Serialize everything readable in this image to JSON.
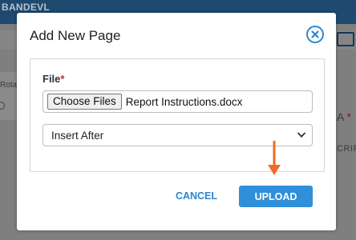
{
  "background": {
    "brand": "BANDEVL",
    "left_label": "Rota",
    "right_label": "A",
    "right_required_mark": "*",
    "right_partial_text": "CRIP"
  },
  "modal": {
    "title": "Add New Page",
    "close_icon": "close-circle-icon",
    "file_field": {
      "label": "File",
      "required_mark": "*",
      "choose_button": "Choose Files",
      "selected_file": "Report Instructions.docx"
    },
    "position_select": {
      "value": "Insert After"
    },
    "buttons": {
      "cancel": "CANCEL",
      "upload": "UPLOAD"
    }
  },
  "annotation": {
    "arrow_color": "#f06a2a",
    "arrow_icon": "arrow-down-icon"
  },
  "colors": {
    "accent": "#2f8fd8",
    "required": "#c62828",
    "header": "#1f4a70"
  }
}
